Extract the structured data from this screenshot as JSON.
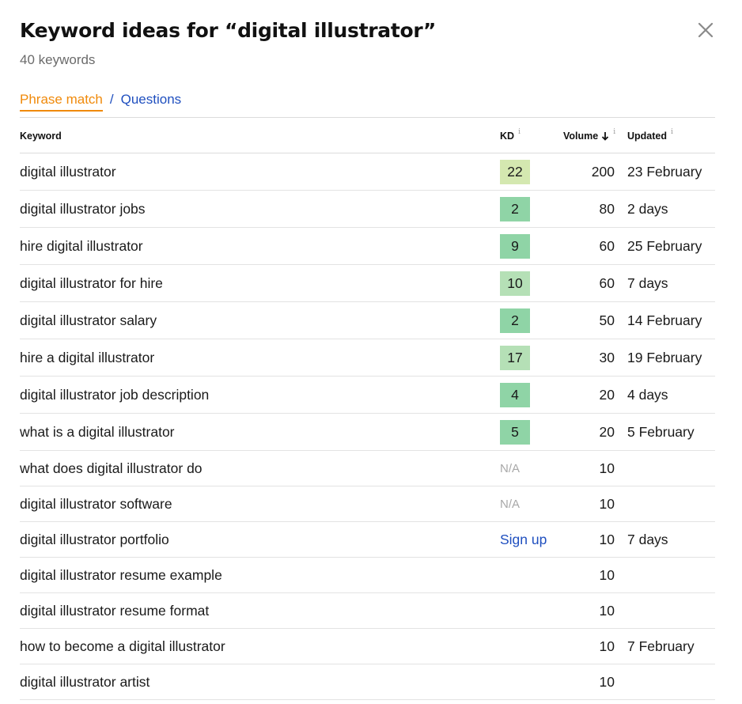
{
  "modal": {
    "title": "Keyword ideas for “digital illustrator”",
    "subtitle": "40 keywords",
    "close_icon": "close-icon"
  },
  "tabs": {
    "active": "Phrase match",
    "separator": "/",
    "other": "Questions"
  },
  "colors": {
    "accent_orange": "#f08a0b",
    "link_blue": "#1f4fbf",
    "kd_easy": "#8fd4a6",
    "kd_low": "#b5e0b6",
    "kd_medium": "#d4e8b0"
  },
  "table": {
    "headers": {
      "keyword": "Keyword",
      "kd": "KD",
      "volume": "Volume",
      "volume_sort_icon": "arrow-down-icon",
      "updated": "Updated",
      "info_glyph": "i"
    },
    "rows": [
      {
        "keyword": "digital illustrator",
        "kd": "22",
        "kd_type": "badge",
        "kd_color": "#d4e8b0",
        "volume": "200",
        "updated": "23 February"
      },
      {
        "keyword": "digital illustrator jobs",
        "kd": "2",
        "kd_type": "badge",
        "kd_color": "#8fd4a6",
        "volume": "80",
        "updated": "2 days"
      },
      {
        "keyword": "hire digital illustrator",
        "kd": "9",
        "kd_type": "badge",
        "kd_color": "#8fd4a6",
        "volume": "60",
        "updated": "25 February"
      },
      {
        "keyword": "digital illustrator for hire",
        "kd": "10",
        "kd_type": "badge",
        "kd_color": "#b5e0b6",
        "volume": "60",
        "updated": "7 days"
      },
      {
        "keyword": "digital illustrator salary",
        "kd": "2",
        "kd_type": "badge",
        "kd_color": "#8fd4a6",
        "volume": "50",
        "updated": "14 February"
      },
      {
        "keyword": "hire a digital illustrator",
        "kd": "17",
        "kd_type": "badge",
        "kd_color": "#b5e0b6",
        "volume": "30",
        "updated": "19 February"
      },
      {
        "keyword": "digital illustrator job description",
        "kd": "4",
        "kd_type": "badge",
        "kd_color": "#8fd4a6",
        "volume": "20",
        "updated": "4 days"
      },
      {
        "keyword": "what is a digital illustrator",
        "kd": "5",
        "kd_type": "badge",
        "kd_color": "#8fd4a6",
        "volume": "20",
        "updated": "5 February"
      },
      {
        "keyword": "what does digital illustrator do",
        "kd": "N/A",
        "kd_type": "na",
        "volume": "10",
        "updated": ""
      },
      {
        "keyword": "digital illustrator software",
        "kd": "N/A",
        "kd_type": "na",
        "volume": "10",
        "updated": ""
      },
      {
        "keyword": "digital illustrator portfolio",
        "kd": "Sign up",
        "kd_type": "signup",
        "volume": "10",
        "updated": "7 days"
      },
      {
        "keyword": "digital illustrator resume example",
        "kd": "",
        "kd_type": "none",
        "volume": "10",
        "updated": ""
      },
      {
        "keyword": "digital illustrator resume format",
        "kd": "",
        "kd_type": "none",
        "volume": "10",
        "updated": ""
      },
      {
        "keyword": "how to become a digital illustrator",
        "kd": "",
        "kd_type": "none",
        "volume": "10",
        "updated": "7 February"
      },
      {
        "keyword": "digital illustrator artist",
        "kd": "",
        "kd_type": "none",
        "volume": "10",
        "updated": ""
      }
    ]
  }
}
